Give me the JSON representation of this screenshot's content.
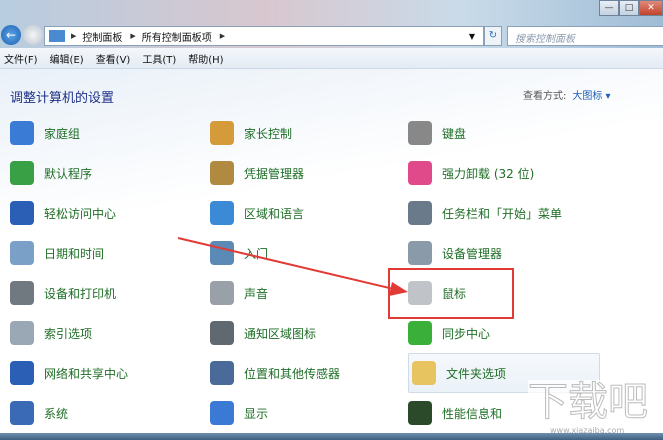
{
  "window": {
    "min": "—",
    "max": "□",
    "close": "✕"
  },
  "address": {
    "crumbs": [
      "控制面板",
      "所有控制面板项"
    ],
    "search_placeholder": "搜索控制面板"
  },
  "menu": [
    "文件(F)",
    "编辑(E)",
    "查看(V)",
    "工具(T)",
    "帮助(H)"
  ],
  "heading": "调整计算机的设置",
  "view_by": {
    "label": "查看方式:",
    "value": "大图标 ▾"
  },
  "items": [
    {
      "label": "家庭组",
      "color": "#3a7bd5"
    },
    {
      "label": "家长控制",
      "color": "#d59b3a"
    },
    {
      "label": "键盘",
      "color": "#888888"
    },
    {
      "label": "默认程序",
      "color": "#3aa045"
    },
    {
      "label": "凭据管理器",
      "color": "#b08a40"
    },
    {
      "label": "强力卸载 (32 位)",
      "color": "#e04a8a"
    },
    {
      "label": "轻松访问中心",
      "color": "#2a5fb5"
    },
    {
      "label": "区域和语言",
      "color": "#3a8ad5"
    },
    {
      "label": "任务栏和「开始」菜单",
      "color": "#6a7a8a"
    },
    {
      "label": "日期和时间",
      "color": "#7aa0c8"
    },
    {
      "label": "入门",
      "color": "#5a8ab5"
    },
    {
      "label": "设备管理器",
      "color": "#8a9aa8"
    },
    {
      "label": "设备和打印机",
      "color": "#707880"
    },
    {
      "label": "声音",
      "color": "#9aa0a8"
    },
    {
      "label": "鼠标",
      "color": "#c0c4c8"
    },
    {
      "label": "索引选项",
      "color": "#9aa8b5"
    },
    {
      "label": "通知区域图标",
      "color": "#606870"
    },
    {
      "label": "同步中心",
      "color": "#3ab03a"
    },
    {
      "label": "网络和共享中心",
      "color": "#2a5fb5"
    },
    {
      "label": "位置和其他传感器",
      "color": "#4a6a9a"
    },
    {
      "label": "文件夹选项",
      "color": "#e8c460"
    },
    {
      "label": "系统",
      "color": "#3a6ab5"
    },
    {
      "label": "显示",
      "color": "#3a7ad5"
    },
    {
      "label": "性能信息和",
      "color": "#2a4a2a"
    }
  ],
  "watermark": {
    "text": "下载吧",
    "url": "www.xiazaiba.com"
  }
}
